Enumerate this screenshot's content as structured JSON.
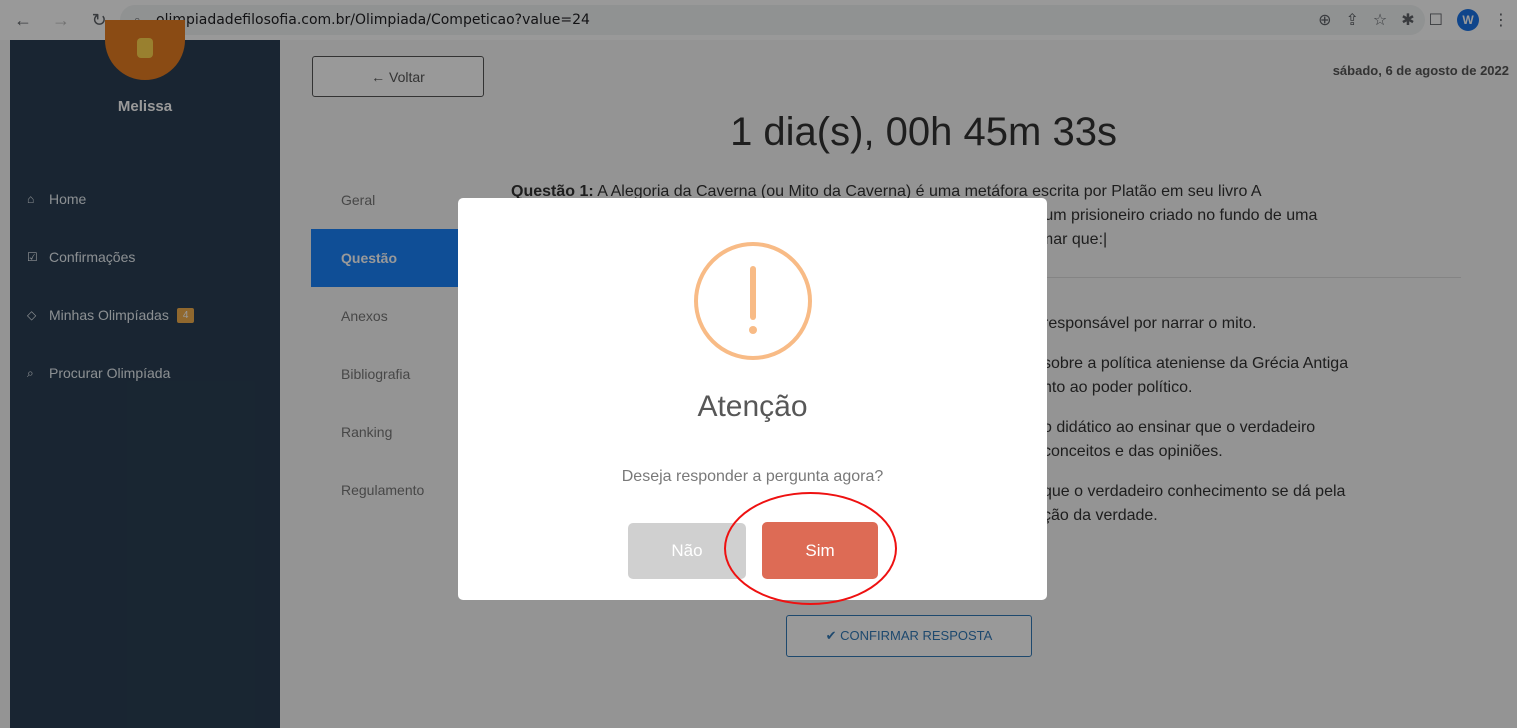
{
  "browser": {
    "url": "olimpiadadefilosofia.com.br/Olimpiada/Competicao?value=24",
    "avatar_letter": "W"
  },
  "sidebar": {
    "user_name": "Melissa",
    "items": [
      {
        "icon": "home-icon",
        "label": "Home"
      },
      {
        "icon": "check-square-icon",
        "label": "Confirmações"
      },
      {
        "icon": "diamond-icon",
        "label": "Minhas Olimpíadas",
        "badge": "4"
      },
      {
        "icon": "search-icon",
        "label": "Procurar Olimpíada"
      }
    ]
  },
  "main": {
    "back_label": "← Voltar",
    "date": "sábado, 6 de agosto de 2022",
    "timer": "1 dia(s), 00h 45m 33s",
    "tabs": [
      "Geral",
      "Questão",
      "Anexos",
      "Bibliografia",
      "Ranking",
      "Regulamento"
    ],
    "question_label": "Questão 1:",
    "question_text": "A Alegoria da Caverna (ou Mito da Caverna) é uma metáfora escrita por Platão em seu livro A",
    "question_line2": "e um prisioneiro criado no fundo de uma",
    "question_line3": "irmar que:|",
    "options": [
      [
        "responsável por narrar o mito."
      ],
      [
        "sobre a política ateniense da Grécia Antiga",
        "nto ao poder político."
      ],
      [
        "o didático ao ensinar que o verdadeiro",
        "conceitos e das opiniões."
      ],
      [
        "que o verdadeiro conhecimento se dá pela",
        "ção da verdade."
      ]
    ],
    "confirm_label": "✔ CONFIRMAR RESPOSTA"
  },
  "modal": {
    "title": "Atenção",
    "text": "Deseja responder a pergunta agora?",
    "no_label": "Não",
    "yes_label": "Sim"
  },
  "colors": {
    "sidebar": "#2a3f54",
    "active_tab": "#1a82fb",
    "warning": "#f8bb86",
    "confirm": "#dd6b55",
    "highlight": "#e11"
  }
}
